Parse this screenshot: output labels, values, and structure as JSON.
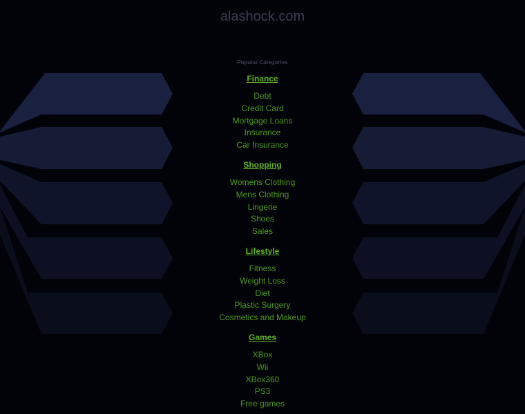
{
  "site": {
    "domain": "alashock.com",
    "popular_label": "Popular Categories"
  },
  "colors": {
    "background": "#020308",
    "link_green": "#4f9a1e",
    "heading_green": "#63b02a",
    "title_gray": "#3a3f50",
    "panel_blue": "#1a2040"
  },
  "categories": [
    {
      "heading": "Finance",
      "links": [
        "Debt",
        "Credit Card",
        "Mortgage Loans",
        "Insurance",
        "Car Insurance"
      ]
    },
    {
      "heading": "Shopping",
      "links": [
        "Womens Clothing",
        "Mens Clothing",
        "Lingerie",
        "Shoes",
        "Sales"
      ]
    },
    {
      "heading": "Lifestyle",
      "links": [
        "Fitness",
        "Weight Loss",
        "Diet",
        "Plastic Surgery",
        "Cosmetics and Makeup"
      ]
    },
    {
      "heading": "Games",
      "links": [
        "XBox",
        "Wii",
        "XBox360",
        "PS3",
        "Free games"
      ]
    }
  ]
}
